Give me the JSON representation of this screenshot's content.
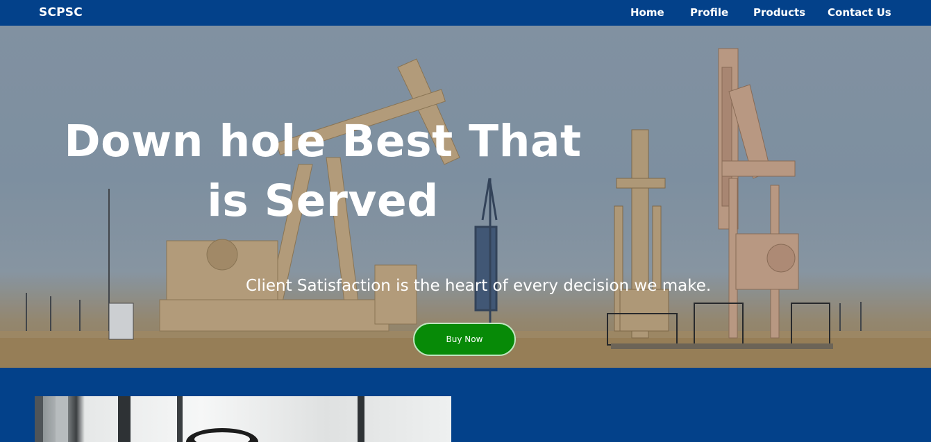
{
  "brand": "SCPSC",
  "nav": {
    "home": "Home",
    "profile": "Profile",
    "products": "Products",
    "contact": "Contact Us"
  },
  "hero": {
    "title": "Down hole Best That is Served",
    "subtitle": "Client Satisfaction is the heart of every decision we make.",
    "button_label": "Buy Now"
  },
  "colors": {
    "nav_bg": "#03418a",
    "button_bg": "#078a07"
  }
}
